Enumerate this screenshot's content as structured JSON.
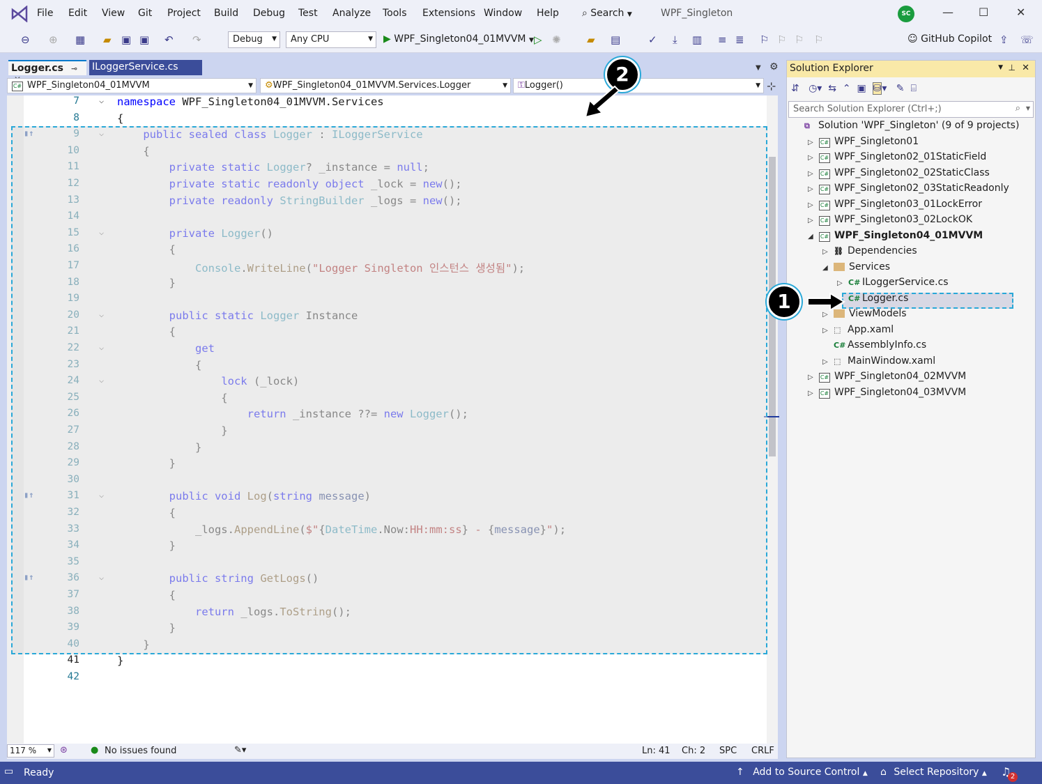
{
  "menu": {
    "items": [
      "File",
      "Edit",
      "View",
      "Git",
      "Project",
      "Build",
      "Debug",
      "Test",
      "Analyze",
      "Tools",
      "Extensions",
      "Window",
      "Help"
    ],
    "search": "Search",
    "solution_title": "WPF_Singleton",
    "avatar": "SC"
  },
  "toolbar": {
    "config": "Debug",
    "platform": "Any CPU",
    "run_target": "WPF_Singleton04_01MVVM",
    "copilot": "GitHub Copilot"
  },
  "tabs": {
    "active": "Logger.cs",
    "other": "ILoggerService.cs"
  },
  "nav": {
    "project": "WPF_Singleton04_01MVVM",
    "type": "WPF_Singleton04_01MVVM.Services.Logger",
    "member": "Logger()"
  },
  "code": {
    "lines": [
      {
        "n": "7",
        "html": "<span class='kw'>namespace</span> WPF_Singleton04_01MVVM.Services"
      },
      {
        "n": "8",
        "html": "{"
      },
      {
        "n": "9",
        "html": "    <span class='kw'>public sealed class</span> <span class='ty'>Logger</span> : <span class='ty'>ILoggerService</span>"
      },
      {
        "n": "10",
        "html": "    {"
      },
      {
        "n": "11",
        "html": "        <span class='kw'>private static</span> <span class='ty'>Logger</span>? _instance = <span class='kw'>null</span>;"
      },
      {
        "n": "12",
        "html": "        <span class='kw'>private static readonly object</span> _lock = <span class='kw'>new</span>();"
      },
      {
        "n": "13",
        "html": "        <span class='kw'>private readonly</span> <span class='ty'>StringBuilder</span> _logs = <span class='kw'>new</span>();"
      },
      {
        "n": "14",
        "html": ""
      },
      {
        "n": "15",
        "html": "        <span class='kw'>private</span> <span class='ty'>Logger</span>()"
      },
      {
        "n": "16",
        "html": "        {"
      },
      {
        "n": "17",
        "html": "            <span class='ty'>Console</span>.<span class='mt'>WriteLine</span>(<span class='st'>\"Logger Singleton 인스턴스 생성됨\"</span>);"
      },
      {
        "n": "18",
        "html": "        }"
      },
      {
        "n": "19",
        "html": ""
      },
      {
        "n": "20",
        "html": "        <span class='kw'>public static</span> <span class='ty'>Logger</span> Instance"
      },
      {
        "n": "21",
        "html": "        {"
      },
      {
        "n": "22",
        "html": "            <span class='kw'>get</span>"
      },
      {
        "n": "23",
        "html": "            {"
      },
      {
        "n": "24",
        "html": "                <span class='kw'>lock</span> (_lock)"
      },
      {
        "n": "25",
        "html": "                {"
      },
      {
        "n": "26",
        "html": "                    <span class='kw'>return</span> _instance ??= <span class='kw'>new</span> <span class='ty'>Logger</span>();"
      },
      {
        "n": "27",
        "html": "                }"
      },
      {
        "n": "28",
        "html": "            }"
      },
      {
        "n": "29",
        "html": "        }"
      },
      {
        "n": "30",
        "html": ""
      },
      {
        "n": "31",
        "html": "        <span class='kw'>public void</span> <span class='mt'>Log</span>(<span class='kw'>string</span> <span class='iv'>message</span>)"
      },
      {
        "n": "32",
        "html": "        {"
      },
      {
        "n": "33",
        "html": "            _logs.<span class='mt'>AppendLine</span>(<span class='st'>$\"</span>{<span class='ty'>DateTime</span>.Now:<span class='st'>HH:mm:ss</span>}<span class='st'> - </span>{<span class='iv'>message</span>}<span class='st'>\"</span>);"
      },
      {
        "n": "34",
        "html": "        }"
      },
      {
        "n": "35",
        "html": ""
      },
      {
        "n": "36",
        "html": "        <span class='kw'>public string</span> <span class='mt'>GetLogs</span>()"
      },
      {
        "n": "37",
        "html": "        {"
      },
      {
        "n": "38",
        "html": "            <span class='kw'>return</span> _logs.<span class='mt'>ToString</span>();"
      },
      {
        "n": "39",
        "html": "        }"
      },
      {
        "n": "40",
        "html": "    }"
      },
      {
        "n": "41",
        "html": "}"
      },
      {
        "n": "42",
        "html": ""
      }
    ]
  },
  "editor_status": {
    "zoom": "117 %",
    "issues": "No issues found",
    "ln": "Ln: 41",
    "ch": "Ch: 2",
    "spc": "SPC",
    "crlf": "CRLF"
  },
  "solution_explorer": {
    "title": "Solution Explorer",
    "search_placeholder": "Search Solution Explorer (Ctrl+;)",
    "solution": "Solution 'WPF_Singleton' (9 of 9 projects)",
    "items": [
      "WPF_Singleton01",
      "WPF_Singleton02_01StaticField",
      "WPF_Singleton02_02StaticClass",
      "WPF_Singleton02_03StaticReadonly",
      "WPF_Singleton03_01LockError",
      "WPF_Singleton03_02LockOK",
      "WPF_Singleton04_01MVVM",
      "Dependencies",
      "Services",
      "ILoggerService.cs",
      "Logger.cs",
      "ViewModels",
      "App.xaml",
      "AssemblyInfo.cs",
      "MainWindow.xaml",
      "WPF_Singleton04_02MVVM",
      "WPF_Singleton04_03MVVM"
    ]
  },
  "statusbar": {
    "ready": "Ready",
    "source_control": "Add to Source Control",
    "repository": "Select Repository",
    "notifications": "2"
  },
  "callouts": {
    "one": "1",
    "two": "2"
  }
}
